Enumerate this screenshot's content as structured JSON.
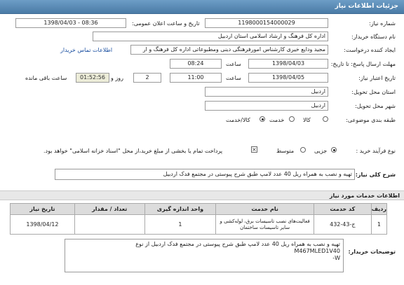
{
  "header": {
    "title": "جزئیات اطلاعات نیاز"
  },
  "form": {
    "need_number": {
      "label": "شماره نیاز:",
      "value": "1198000154000029"
    },
    "announce_date": {
      "label": "تاریخ و ساعت اعلان عمومی:",
      "value": "1398/04/03 - 08:36"
    },
    "buyer": {
      "label": "نام دستگاه خریدار:",
      "value": "اداره کل فرهنگ و ارشاد اسلامی استان اردبیل"
    },
    "creator": {
      "label": "ایجاد کننده درخواست:",
      "value": "مجید  ودایع خیری کارشناس امورفرهنگی دینی ومطبوعاتی اداره کل فرهنگ و ار",
      "link": "اطلاعات تماس خریدار"
    },
    "response_deadline": {
      "label": "مهلت ارسال پاسخ: تا تاریخ:",
      "date": "1398/04/03",
      "time_label": "ساعت",
      "time": "08:24"
    },
    "validity": {
      "label": "تاریخ اعتبار نیاز:",
      "date": "1398/04/05",
      "time_label": "ساعت",
      "time": "11:00",
      "days": "2",
      "days_label": "روز و",
      "timer": "01:52:56",
      "remaining_label": "ساعت باقی مانده"
    },
    "province": {
      "label": "استان محل تحویل:",
      "value": "اردبیل"
    },
    "city": {
      "label": "شهر محل تحویل:",
      "value": "اردبیل"
    },
    "category": {
      "label": "طبقه بندی موضوعی:",
      "options": [
        "کالا",
        "خدمت",
        "کالا/خدمت"
      ]
    },
    "process": {
      "label": "نوع فرآیند خرید :",
      "options": [
        "جزیی",
        "متوسط"
      ],
      "note": "پرداخت تمام یا بخشی از مبلغ خرید،از محل \"اسناد خزانه اسلامی\" خواهد بود."
    }
  },
  "summary": {
    "label": "شرح کلی نیاز:",
    "value": "تهیه و نصب به همراه  ریل 40 عدد لامپ طبق شرح پیوستی در مجتمع فدک اردبیل"
  },
  "services": {
    "title": "اطلاعات خدمات مورد نیاز",
    "columns": [
      "ردیف",
      "کد خدمت",
      "نام خدمت",
      "واحد اندازه گیری",
      "تعداد / مقدار",
      "تاریخ نیاز"
    ],
    "rows": [
      [
        "1",
        "ج-43-432",
        "فعالیت‌های نصب تاسیسات برق، لوله‌کشی و سایر تاسیسات ساختمان",
        "1",
        "",
        "1398/04/12"
      ]
    ]
  },
  "buyer_notes": {
    "label": "توضیحات خریدار:",
    "line1": "تهیه و نصب به همراه  ریل 40 عدد لامپ طبق شرح پیوستی در مجتمع فدک اردبیل از نوع",
    "line2": "M467MLED1V40",
    "line3": "W-"
  }
}
